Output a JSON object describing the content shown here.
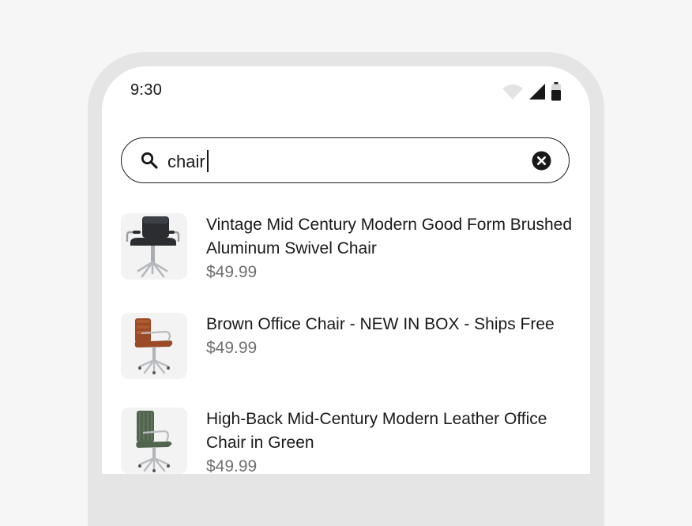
{
  "status_bar": {
    "time": "9:30",
    "icons": [
      "wifi-icon",
      "cellular-signal-icon",
      "battery-icon"
    ]
  },
  "search": {
    "query": "chair",
    "icon": "search-icon",
    "clear_icon": "clear-icon"
  },
  "results": [
    {
      "title": "Vintage Mid Century Modern Good Form Brushed Aluminum Swivel Chair",
      "price": "$49.99",
      "image": "black-leather-swivel-chair"
    },
    {
      "title": "Brown Office Chair - NEW IN BOX - Ships Free",
      "price": "$49.99",
      "image": "brown-leather-office-chair"
    },
    {
      "title": "High-Back Mid-Century Modern Leather Office Chair in Green",
      "price": "$49.99",
      "image": "green-leather-office-chair"
    }
  ],
  "colors": {
    "background": "#f6f6f6",
    "bezel": "#e5e5e5",
    "screen": "#ffffff",
    "text": "#191919",
    "price": "#707070",
    "thumbnail_bg": "#f3f3f3"
  }
}
